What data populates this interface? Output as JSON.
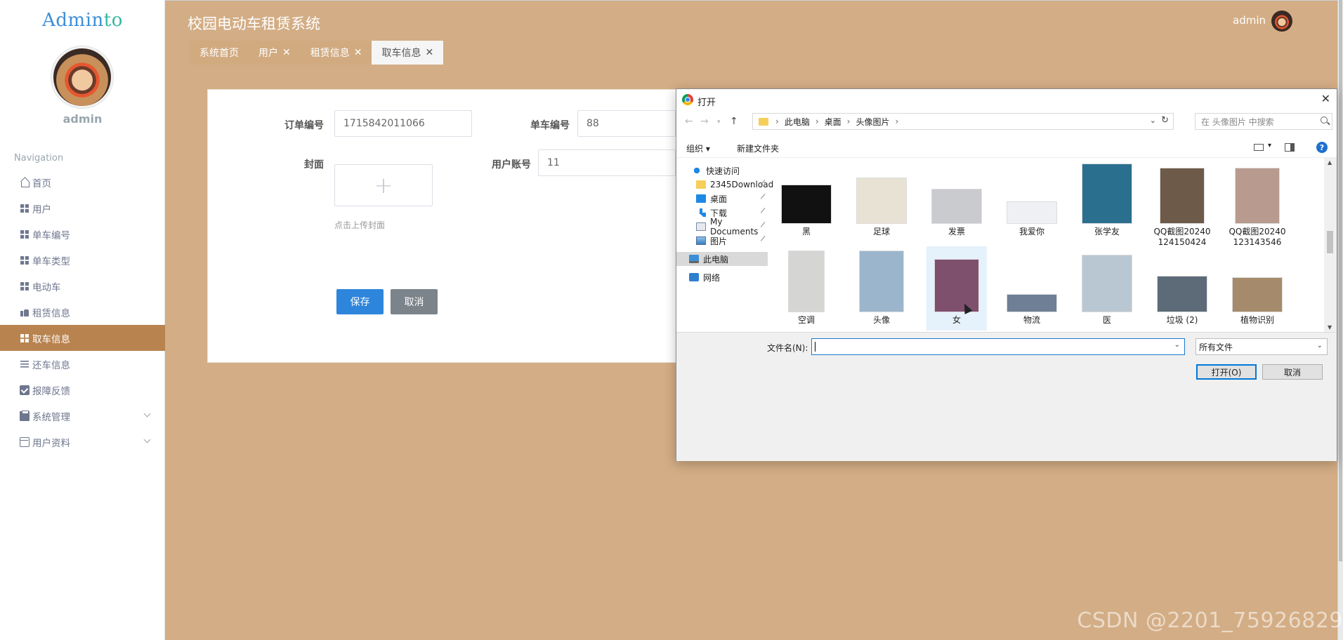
{
  "sidebar": {
    "brand_part1": "Admin",
    "brand_part2": "to",
    "username": "admin",
    "nav_title": "Navigation",
    "items": [
      {
        "label": "首页",
        "icon": "home-icon"
      },
      {
        "label": "用户",
        "icon": "grid-icon"
      },
      {
        "label": "单车编号",
        "icon": "grid-icon"
      },
      {
        "label": "单车类型",
        "icon": "grid-icon"
      },
      {
        "label": "电动车",
        "icon": "grid-icon"
      },
      {
        "label": "租赁信息",
        "icon": "thumb-icon"
      },
      {
        "label": "取车信息",
        "icon": "grid-icon",
        "active": true
      },
      {
        "label": "还车信息",
        "icon": "list-icon"
      },
      {
        "label": "报障反馈",
        "icon": "check-icon"
      },
      {
        "label": "系统管理",
        "icon": "clipboard-icon",
        "expandable": true
      },
      {
        "label": "用户资料",
        "icon": "card-icon",
        "expandable": true
      }
    ]
  },
  "header": {
    "title": "校园电动车租赁系统",
    "username": "admin"
  },
  "tabs": [
    {
      "label": "系统首页",
      "closable": false,
      "active": false
    },
    {
      "label": "用户",
      "closable": true,
      "active": false
    },
    {
      "label": "租赁信息",
      "closable": true,
      "active": false
    },
    {
      "label": "取车信息",
      "closable": true,
      "active": true
    }
  ],
  "form": {
    "order_label": "订单编号",
    "order_value": "1715842011066",
    "bike_label": "单车编号",
    "bike_value": "88",
    "cover_label": "封面",
    "cover_plus": "+",
    "cover_hint": "点击上传封面",
    "account_label": "用户账号",
    "account_value": "11",
    "save_label": "保存",
    "cancel_label": "取消"
  },
  "dialog": {
    "title": "打开",
    "close_glyph": "✕",
    "breadcrumbs": [
      "此电脑",
      "桌面",
      "头像图片"
    ],
    "search_placeholder": "在 头像图片 中搜索",
    "organize_label": "组织 ▾",
    "new_folder_label": "新建文件夹",
    "help_glyph": "?",
    "tree": [
      {
        "label": "快速访问",
        "icon": "star-icon"
      },
      {
        "label": "2345Download",
        "icon": "folder-icon",
        "pinned": true
      },
      {
        "label": "桌面",
        "icon": "desktop-icon",
        "pinned": true
      },
      {
        "label": "下载",
        "icon": "download-icon",
        "pinned": true
      },
      {
        "label": "My Documents",
        "icon": "document-icon",
        "pinned": true
      },
      {
        "label": "图片",
        "icon": "pictures-icon",
        "pinned": true
      },
      {
        "label": "此电脑",
        "icon": "computer-icon",
        "selected": true
      },
      {
        "label": "网络",
        "icon": "network-icon"
      }
    ],
    "files": [
      {
        "name": "黑",
        "color": "#111111"
      },
      {
        "name": "足球",
        "color": "#e8e2d4"
      },
      {
        "name": "发票",
        "color": "#c9cbce"
      },
      {
        "name": "我爱你",
        "color": "#eef0f4"
      },
      {
        "name": "张学友",
        "color": "#2b6f8f"
      },
      {
        "name": "QQ截图20240124150424",
        "color": "#6d5a48"
      },
      {
        "name": "QQ截图20240123143546",
        "color": "#b89a8e"
      },
      {
        "name": "空调",
        "color": "#d5d5d3"
      },
      {
        "name": "头像",
        "color": "#9bb6cc"
      },
      {
        "name": "女",
        "color": "#7f4f6e",
        "selected": true
      },
      {
        "name": "物流",
        "color": "#6e7f96"
      },
      {
        "name": "医",
        "color": "#b9c7d2"
      },
      {
        "name": "垃圾 (2)",
        "color": "#5d6b78"
      },
      {
        "name": "植物识别",
        "color": "#a58b6b"
      },
      {
        "name": "",
        "color": "#3a3a2a"
      },
      {
        "name": "",
        "color": "#9fc29c"
      },
      {
        "name": "",
        "color": "#b5856f"
      },
      {
        "name": "",
        "color": "#8ea26a"
      },
      {
        "name": "",
        "color": "#d94d3a"
      },
      {
        "name": "",
        "color": "#2a3f8f"
      },
      {
        "name": "",
        "color": "#2b3140"
      }
    ],
    "filename_label": "文件名(N):",
    "filename_value": "",
    "filetype_value": "所有文件",
    "open_label": "打开(O)",
    "cancel_label": "取消"
  },
  "watermark": "CSDN @2201_75926829",
  "colors": {
    "page_bg": "#d3ad85",
    "active_menu": "#b8834f",
    "save_button": "#2d85dc",
    "cancel_button": "#7b838b"
  }
}
